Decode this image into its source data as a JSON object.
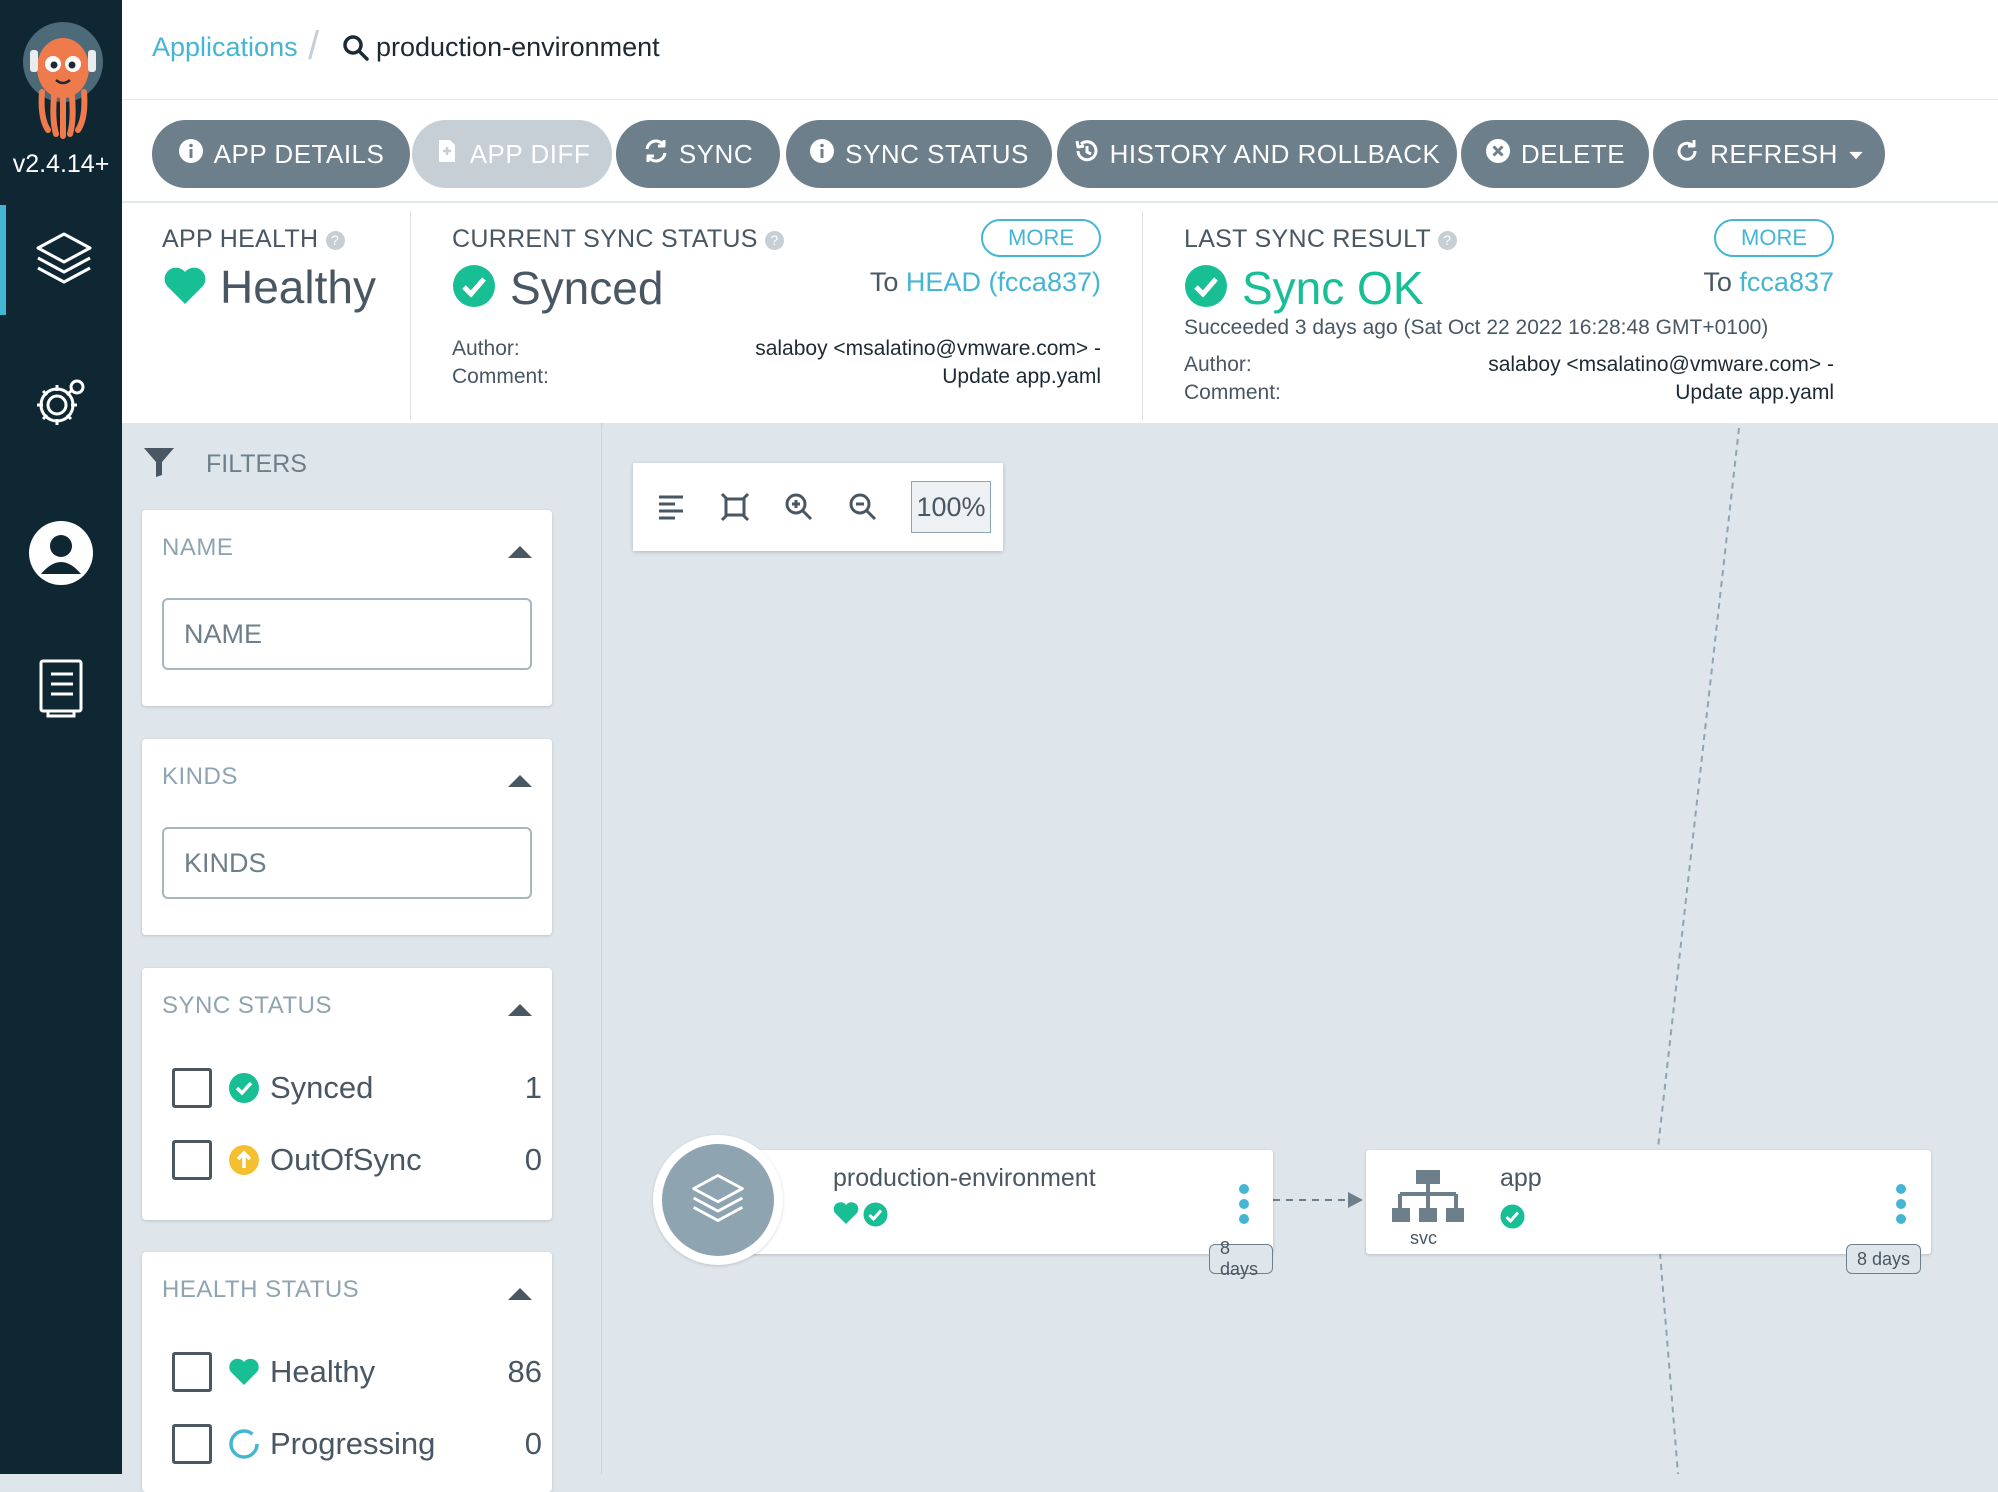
{
  "sidebar": {
    "version": "v2.4.14+",
    "nav": [
      "applications-icon",
      "settings-icon",
      "user-icon",
      "docs-icon"
    ]
  },
  "breadcrumb": {
    "root": "Applications",
    "current": "production-environment"
  },
  "toolbar": {
    "app_details": "APP DETAILS",
    "app_diff": "APP DIFF",
    "sync": "SYNC",
    "sync_status": "SYNC STATUS",
    "history": "HISTORY AND ROLLBACK",
    "delete": "DELETE",
    "refresh": "REFRESH"
  },
  "summary": {
    "health": {
      "title": "APP HEALTH",
      "value": "Healthy"
    },
    "current_sync": {
      "title": "CURRENT SYNC STATUS",
      "more": "MORE",
      "value": "Synced",
      "to_label": "To",
      "to_ref": "HEAD (fcca837)",
      "author_label": "Author:",
      "author": "salaboy <msalatino@vmware.com> -",
      "comment_label": "Comment:",
      "comment": "Update app.yaml"
    },
    "last_sync": {
      "title": "LAST SYNC RESULT",
      "more": "MORE",
      "value": "Sync OK",
      "to_label": "To",
      "to_ref": "fcca837",
      "succeeded": "Succeeded 3 days ago (Sat Oct 22 2022 16:28:48 GMT+0100)",
      "author_label": "Author:",
      "author": "salaboy <msalatino@vmware.com> -",
      "comment_label": "Comment:",
      "comment": "Update app.yaml"
    }
  },
  "filters": {
    "header": "FILTERS",
    "name": {
      "title": "NAME",
      "placeholder": "NAME"
    },
    "kinds": {
      "title": "KINDS",
      "placeholder": "KINDS"
    },
    "sync_status": {
      "title": "SYNC STATUS",
      "items": [
        {
          "label": "Synced",
          "count": "1"
        },
        {
          "label": "OutOfSync",
          "count": "0"
        }
      ]
    },
    "health_status": {
      "title": "HEALTH STATUS",
      "items": [
        {
          "label": "Healthy",
          "count": "86"
        },
        {
          "label": "Progressing",
          "count": "0"
        }
      ]
    }
  },
  "canvas": {
    "zoom": "100%",
    "app_node": {
      "name": "production-environment",
      "age": "8 days"
    },
    "svc_node": {
      "name": "app",
      "kind": "svc",
      "age": "8 days"
    }
  },
  "colors": {
    "sidebar": "#0f2733",
    "button": "#6d7f8b",
    "button_disabled": "#c6cfd5",
    "accent": "#44b5d3",
    "healthy": "#18be94",
    "outofsync": "#f4c030"
  }
}
